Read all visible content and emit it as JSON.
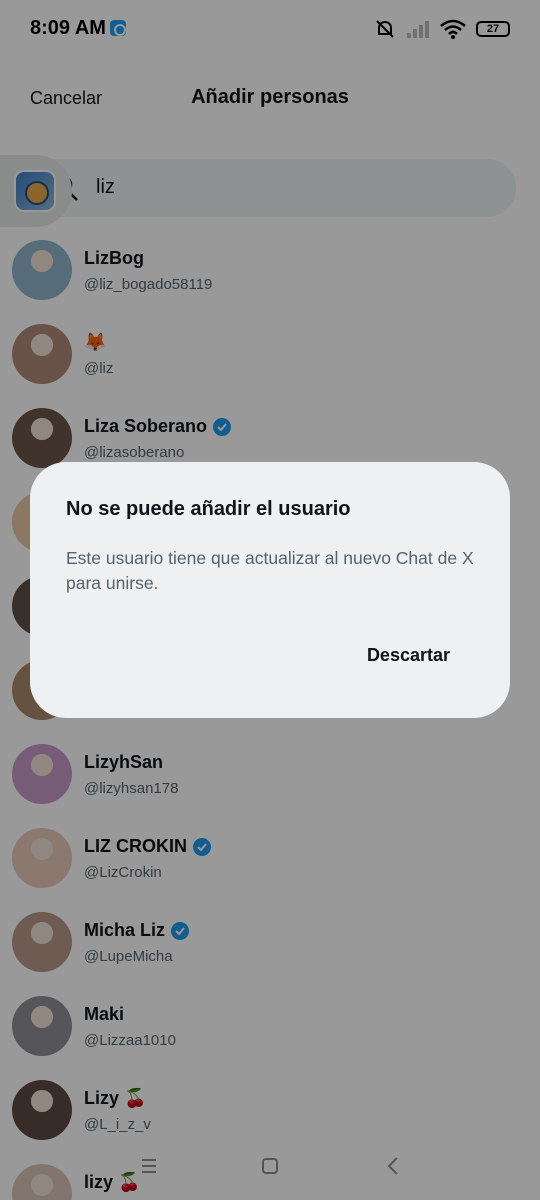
{
  "status": {
    "time": "8:09 AM",
    "battery": "27"
  },
  "header": {
    "cancel": "Cancelar",
    "title": "Añadir personas"
  },
  "search": {
    "value": "liz"
  },
  "list": [
    {
      "name": "LizBog",
      "handle": "@liz_bogado58119",
      "verified": false,
      "avatar_color": "#8fb4c9"
    },
    {
      "name": "🦊",
      "handle": "@liz",
      "verified": false,
      "avatar_color": "#b08a78"
    },
    {
      "name": "Liza Soberano",
      "handle": "@lizasoberano",
      "verified": true,
      "avatar_color": "#6b5648"
    },
    {
      "name": "",
      "handle": "",
      "verified": false,
      "avatar_color": "#e7c9a5"
    },
    {
      "name": "",
      "handle": "",
      "verified": false,
      "avatar_color": "#5d5149"
    },
    {
      "name": "",
      "handle": "",
      "verified": false,
      "avatar_color": "#a88a6c"
    },
    {
      "name": "LizyhSan",
      "handle": "@lizyhsan178",
      "verified": false,
      "avatar_color": "#c79ac8"
    },
    {
      "name": "LIZ CROKIN",
      "handle": "@LizCrokin",
      "verified": true,
      "avatar_color": "#e8c9b8"
    },
    {
      "name": "Micha Liz",
      "handle": "@LupeMicha",
      "verified": true,
      "avatar_color": "#b89a8a"
    },
    {
      "name": "Maki",
      "handle": "@Lizzaa1010",
      "verified": false,
      "avatar_color": "#8e8e96"
    },
    {
      "name": "Lizy 🍒",
      "handle": "@L_i_z_v",
      "verified": false,
      "avatar_color": "#5e4a44"
    },
    {
      "name": "lizy 🍒",
      "handle": "",
      "verified": false,
      "avatar_color": "#d8c4b8"
    }
  ],
  "dialog": {
    "title": "No se puede añadir el usuario",
    "message": "Este usuario tiene que actualizar al nuevo Chat de X para unirse.",
    "button": "Descartar"
  },
  "colors": {
    "verified": "#1d9bf0",
    "dialog_bg": "#eef0f2",
    "overlay": "rgba(0,0,0,0.40)"
  },
  "icons": [
    "app-notification-icon",
    "muted-bell-icon",
    "signal-icon",
    "wifi-icon",
    "battery-icon",
    "search-icon",
    "verified-badge-icon",
    "menu-icon",
    "home-icon",
    "back-icon"
  ]
}
